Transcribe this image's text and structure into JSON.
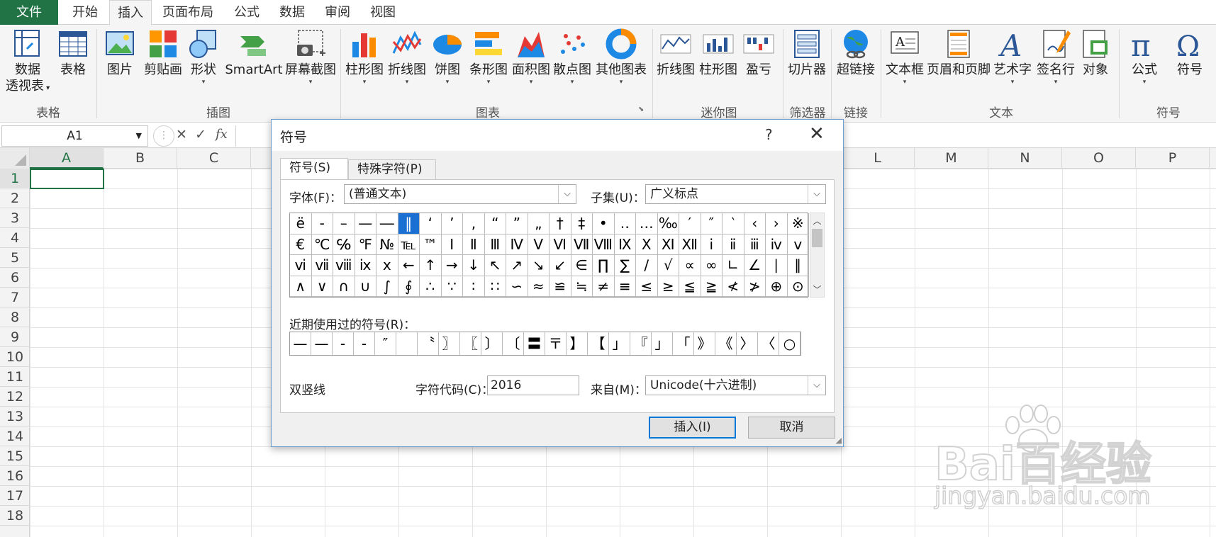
{
  "tabs": [
    {
      "label": "文件"
    },
    {
      "label": "开始"
    },
    {
      "label": "插入"
    },
    {
      "label": "页面布局"
    },
    {
      "label": "公式"
    },
    {
      "label": "数据"
    },
    {
      "label": "审阅"
    },
    {
      "label": "视图"
    }
  ],
  "ribbon": {
    "buttons": [
      {
        "label": "数据",
        "label2": "透视表"
      },
      {
        "label": "表格"
      },
      {
        "label": "图片"
      },
      {
        "label": "剪贴画"
      },
      {
        "label": "形状"
      },
      {
        "label": "SmartArt"
      },
      {
        "label": "屏幕截图"
      },
      {
        "label": "柱形图"
      },
      {
        "label": "折线图"
      },
      {
        "label": "饼图"
      },
      {
        "label": "条形图"
      },
      {
        "label": "面积图"
      },
      {
        "label": "散点图"
      },
      {
        "label": "其他图表"
      },
      {
        "label": "折线图"
      },
      {
        "label": "柱形图"
      },
      {
        "label": "盈亏"
      },
      {
        "label": "切片器"
      },
      {
        "label": "超链接"
      },
      {
        "label": "文本框"
      },
      {
        "label": "页眉和页脚"
      },
      {
        "label": "艺术字"
      },
      {
        "label": "签名行"
      },
      {
        "label": "对象"
      },
      {
        "label": "公式"
      },
      {
        "label": "符号"
      }
    ],
    "groups": [
      {
        "label": "表格"
      },
      {
        "label": "插图"
      },
      {
        "label": "图表"
      },
      {
        "label": "迷你图"
      },
      {
        "label": "筛选器"
      },
      {
        "label": "链接"
      },
      {
        "label": "文本"
      },
      {
        "label": "符号"
      }
    ]
  },
  "formula_bar": {
    "name_box": "A1",
    "fx_label": "fx"
  },
  "columns": [
    {
      "label": "A"
    },
    {
      "label": "B"
    },
    {
      "label": "C"
    },
    {
      "label": "L"
    },
    {
      "label": "M"
    },
    {
      "label": "N"
    },
    {
      "label": "O"
    },
    {
      "label": "P"
    }
  ],
  "rows": [
    "1",
    "2",
    "3",
    "4",
    "5",
    "6",
    "7",
    "8",
    "9",
    "10",
    "11",
    "12",
    "13",
    "14",
    "15",
    "16",
    "17",
    "18"
  ],
  "dialog": {
    "title": "符号",
    "help": "?",
    "close": "✕",
    "tabs": [
      {
        "label": "符号(S)"
      },
      {
        "label": "特殊字符(P)"
      }
    ],
    "font_label": "字体(F)：",
    "font_value": "(普通文本)",
    "subset_label": "子集(U)：",
    "subset_value": "广义标点",
    "symbols": [
      "ë",
      "‐",
      "–",
      "—",
      "―",
      "‖",
      "‘",
      "’",
      "‚",
      "“",
      "”",
      "„",
      "†",
      "‡",
      "•",
      "‥",
      "…",
      "‰",
      "′",
      "″",
      "‵",
      "‹",
      "›",
      "※",
      "€",
      "℃",
      "℅",
      "℉",
      "№",
      "℡",
      "™",
      "Ⅰ",
      "Ⅱ",
      "Ⅲ",
      "Ⅳ",
      "Ⅴ",
      "Ⅵ",
      "Ⅶ",
      "Ⅷ",
      "Ⅸ",
      "Ⅹ",
      "Ⅺ",
      "Ⅻ",
      "ⅰ",
      "ⅱ",
      "ⅲ",
      "ⅳ",
      "ⅴ",
      "ⅵ",
      "ⅶ",
      "ⅷ",
      "ⅸ",
      "ⅹ",
      "←",
      "↑",
      "→",
      "↓",
      "↖",
      "↗",
      "↘",
      "↙",
      "∈",
      "∏",
      "∑",
      "∕",
      "√",
      "∝",
      "∞",
      "∟",
      "∠",
      "∣",
      "∥",
      "∧",
      "∨",
      "∩",
      "∪",
      "∫",
      "∮",
      "∴",
      "∵",
      "∶",
      "∷",
      "∽",
      "≈",
      "≌",
      "≒",
      "≠",
      "≡",
      "≤",
      "≥",
      "≦",
      "≧",
      "≮",
      "≯",
      "⊕",
      "⊙"
    ],
    "selected_index": 5,
    "recent_label": "近期使用过的符号(R)：",
    "recent": [
      "—",
      "—",
      "-",
      "-",
      "″",
      "",
      "〝",
      "〗",
      "〖",
      "〕",
      "〔",
      "〓",
      "〒",
      "】",
      "【",
      "」",
      "『",
      "」",
      "「",
      "》",
      "《",
      "〉",
      "〈",
      "○"
    ],
    "char_name": "双竖线",
    "code_label": "字符代码(C)：",
    "code_value": "2016",
    "from_label": "来自(M)：",
    "from_value": "Unicode(十六进制)",
    "insert_label": "插入(I)",
    "cancel_label": "取消"
  },
  "watermark": {
    "text1": "Bai百经验",
    "text2": "jingyan.baidu.com"
  },
  "colors": {
    "excel_green": "#217346",
    "selection": "#1a6fd2"
  }
}
